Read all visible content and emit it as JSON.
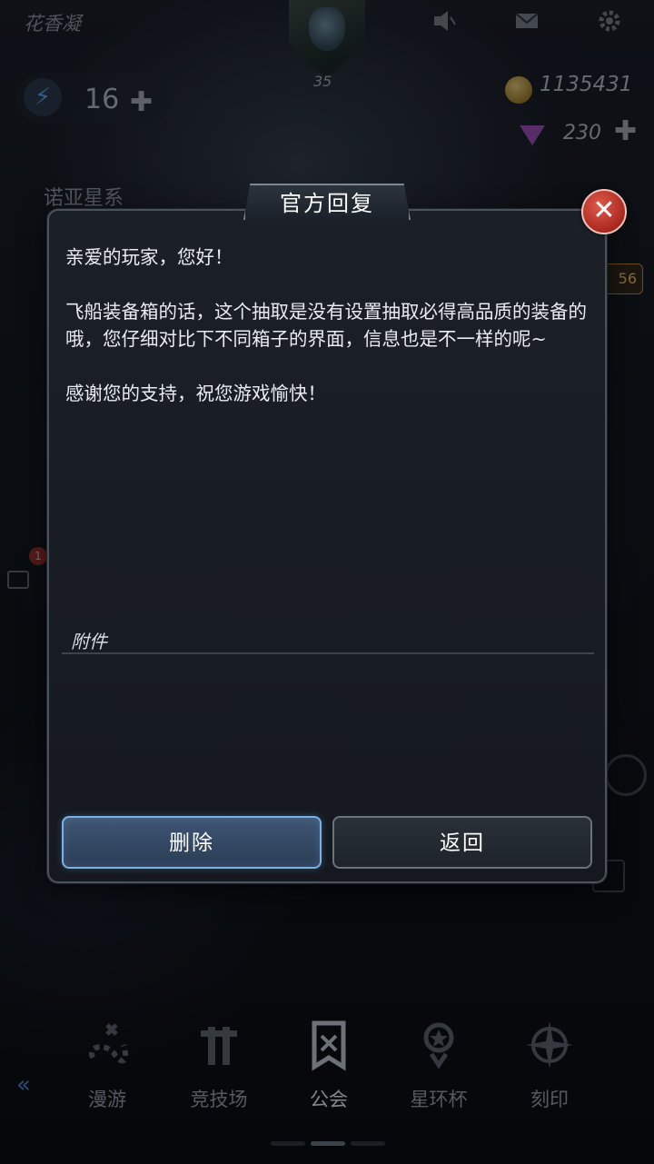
{
  "hud": {
    "player_name": "花香凝",
    "level": "35",
    "energy": "16",
    "coins": "1135431",
    "gems": "230",
    "system_name": "诺亚星系",
    "side_value": "56",
    "notification_count": "1"
  },
  "dialog": {
    "title": "官方回复",
    "greeting": "亲爱的玩家，您好！",
    "body": "飞船装备箱的话，这个抽取是没有设置抽取必得高品质的装备的哦，您仔细对比下不同箱子的界面，信息也是不一样的呢~",
    "closing": "感谢您的支持，祝您游戏愉快！",
    "attachment_label": "附件",
    "delete_label": "删除",
    "back_label": "返回"
  },
  "nav": {
    "items": [
      {
        "label": "漫游",
        "icon": "roam-icon"
      },
      {
        "label": "竞技场",
        "icon": "arena-icon"
      },
      {
        "label": "公会",
        "icon": "guild-banner-icon"
      },
      {
        "label": "星环杯",
        "icon": "trophy-icon"
      },
      {
        "label": "刻印",
        "icon": "star-compass-icon"
      }
    ],
    "active": "公会"
  },
  "colors": {
    "accent_blue": "#7fb0e4",
    "close_red": "#c0392b",
    "dialog_bg": "#1b2027"
  }
}
